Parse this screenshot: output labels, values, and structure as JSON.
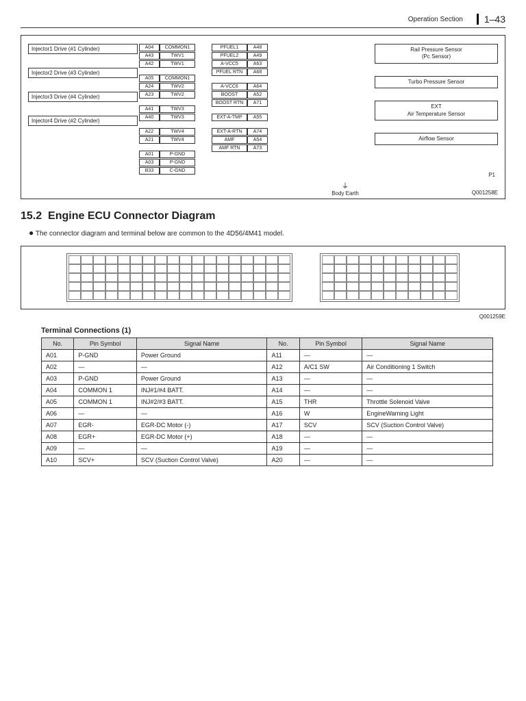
{
  "header": {
    "section": "Operation Section",
    "page": "1–43"
  },
  "wiring": {
    "injectors": [
      "Injector1 Drive (#1 Cylinder)",
      "Injector2 Drive (#3 Cylinder)",
      "Injector3 Drive (#4 Cylinder)",
      "Injector4 Drive (#2 Cylinder)"
    ],
    "mid_left": [
      [
        "A04",
        "COMMON1"
      ],
      [
        "A43",
        "TWV1"
      ],
      [
        "A42",
        "TWV1"
      ],
      [
        "A05",
        "COMMON1"
      ],
      [
        "A24",
        "TWV2"
      ],
      [
        "A23",
        "TWV2"
      ],
      [
        "A41",
        "TWV3"
      ],
      [
        "A40",
        "TWV3"
      ],
      [
        "A22",
        "TWV4"
      ],
      [
        "A21",
        "TWV4"
      ],
      [
        "A01",
        "P-GND"
      ],
      [
        "A03",
        "P-GND"
      ],
      [
        "B33",
        "C-GND"
      ]
    ],
    "mid_right": [
      [
        "PFUEL1",
        "A48"
      ],
      [
        "PFUEL2",
        "A49"
      ],
      [
        "A-VCC5",
        "A63"
      ],
      [
        "PFUEL RTN",
        "A68"
      ],
      [
        "A-VCC6",
        "A64"
      ],
      [
        "BOOST",
        "A52"
      ],
      [
        "BOOST RTN",
        "A71"
      ],
      [
        "EXT-A-TMP",
        "A55"
      ],
      [
        "EXT-A-RTN",
        "A74"
      ],
      [
        "AMF",
        "A54"
      ],
      [
        "AMF RTN",
        "A73"
      ]
    ],
    "sensors": [
      "Rail Pressure Sensor\n(Pc Sensor)",
      "Turbo Pressure Sensor",
      "EXT\nAir Temperature Sensor",
      "Airflow Sensor"
    ],
    "body_earth": "Body Earth",
    "p1": "P1",
    "code": "Q001258E"
  },
  "section": {
    "number": "15.2",
    "title": "Engine ECU Connector Diagram",
    "note": "The connector diagram and terminal below are common to the 4D56/4M41 model."
  },
  "connector": {
    "code": "Q001259E"
  },
  "table": {
    "title": "Terminal Connections (1)",
    "headers": [
      "No.",
      "Pin Symbol",
      "Signal Name",
      "No.",
      "Pin Symbol",
      "Signal Name"
    ],
    "rows": [
      [
        "A01",
        "P-GND",
        "Power Ground",
        "A11",
        "—",
        "—"
      ],
      [
        "A02",
        "—",
        "—",
        "A12",
        "A/C1 SW",
        "Air Conditioning 1 Switch"
      ],
      [
        "A03",
        "P-GND",
        "Power Ground",
        "A13",
        "—",
        "—"
      ],
      [
        "A04",
        "COMMON 1",
        "INJ#1/#4 BATT.",
        "A14",
        "—",
        "—"
      ],
      [
        "A05",
        "COMMON 1",
        "INJ#2/#3 BATT.",
        "A15",
        "THR",
        "Throttle Solenoid Valve"
      ],
      [
        "A06",
        "—",
        "—",
        "A16",
        "W",
        "EngineWarning Light"
      ],
      [
        "A07",
        "EGR-",
        "EGR-DC Motor (-)",
        "A17",
        "SCV",
        "SCV (Suction Control Valve)"
      ],
      [
        "A08",
        "EGR+",
        "EGR-DC Motor (+)",
        "A18",
        "—",
        "—"
      ],
      [
        "A09",
        "—",
        "—",
        "A19",
        "—",
        "—"
      ],
      [
        "A10",
        "SCV+",
        "SCV (Suction Control Valve)",
        "A20",
        "—",
        "—"
      ]
    ]
  }
}
